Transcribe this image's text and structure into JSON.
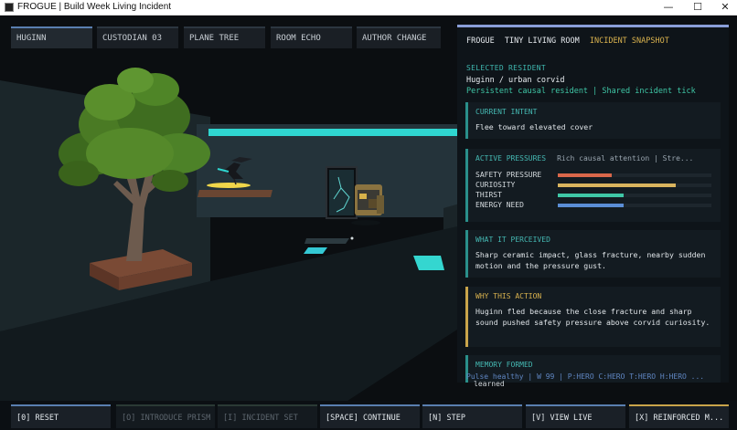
{
  "window": {
    "title": "FROGUE | Build Week Living Incident",
    "minimize": "—",
    "maximize": "☐",
    "close": "✕"
  },
  "tabs": [
    {
      "label": "HUGINN",
      "active": true
    },
    {
      "label": "CUSTODIAN 03",
      "active": false
    },
    {
      "label": "PLANE TREE",
      "active": false
    },
    {
      "label": "ROOM ECHO",
      "active": false
    },
    {
      "label": "AUTHOR CHANGE",
      "active": false
    }
  ],
  "panel": {
    "header": {
      "game": "FROGUE",
      "room": "TINY LIVING ROOM",
      "mode": "INCIDENT SNAPSHOT"
    },
    "selected_label": "SELECTED RESIDENT",
    "resident_name": "Huginn / urban corvid",
    "resident_sub": "Persistent causal resident | Shared incident tick",
    "intent": {
      "title": "CURRENT INTENT",
      "text": "Flee toward elevated cover"
    },
    "pressures": {
      "title": "ACTIVE PRESSURES",
      "note": "Rich causal attention | Stre...",
      "items": [
        {
          "label": "SAFETY PRESSURE",
          "value": 0.35,
          "color": "#d9674a"
        },
        {
          "label": "CURIOSITY",
          "value": 0.77,
          "color": "#d9b45e"
        },
        {
          "label": "THIRST",
          "value": 0.43,
          "color": "#3fc7a6"
        },
        {
          "label": "ENERGY NEED",
          "value": 0.43,
          "color": "#5b8ed6"
        }
      ]
    },
    "perceived": {
      "title": "WHAT IT PERCEIVED",
      "text": "Sharp ceramic impact, glass fracture, nearby sudden motion and the pressure gust."
    },
    "why": {
      "title": "WHY THIS ACTION",
      "text": "Huginn fled because the close fracture and sharp sound pushed safety pressure above corvid curiosity."
    },
    "memory": {
      "title": "MEMORY FORMED"
    },
    "status": "Pulse healthy | W 99 | P:HERO C:HERO T:HERO H:HERO ...",
    "overflow": "learned"
  },
  "bottom_buttons": [
    {
      "label": "[0] RESET",
      "enabled": true
    },
    {
      "label": "[O] INTRODUCE PRISM",
      "enabled": false
    },
    {
      "label": "[I] INCIDENT SET",
      "enabled": false
    },
    {
      "label": "[SPACE] CONTINUE",
      "enabled": true
    },
    {
      "label": "[N] STEP",
      "enabled": true
    },
    {
      "label": "[V] VIEW LIVE",
      "enabled": true
    },
    {
      "label": "[X] REINFORCED M...",
      "enabled": true
    }
  ],
  "scene": {
    "sky_color": "#1d2a2e",
    "accent": "#2fd6d0"
  }
}
